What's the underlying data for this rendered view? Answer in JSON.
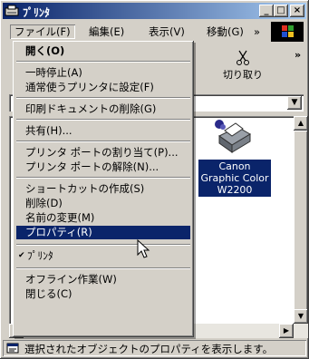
{
  "window": {
    "title": "ﾌﾟﾘﾝﾀ",
    "controls": {
      "minimize": "_",
      "maximize": "□",
      "close": "×"
    }
  },
  "menubar": {
    "items": [
      "ファイル(F)",
      "編集(E)",
      "表示(V)",
      "移動(G)",
      "»"
    ],
    "active_index": 0
  },
  "toolbar": {
    "cut_label": "切り取り",
    "overflow": "»"
  },
  "file_menu": {
    "items": [
      {
        "label": "開く(O)",
        "bold": true
      },
      {
        "separator": true
      },
      {
        "label": "一時停止(A)"
      },
      {
        "label": "通常使うプリンタに設定(F)"
      },
      {
        "separator": true
      },
      {
        "label": "印刷ドキュメントの削除(G)"
      },
      {
        "separator": true
      },
      {
        "label": "共有(H)..."
      },
      {
        "separator": true
      },
      {
        "label": "プリンタ ポートの割り当て(P)..."
      },
      {
        "label": "プリンタ ポートの解除(N)..."
      },
      {
        "separator": true
      },
      {
        "label": "ショートカットの作成(S)"
      },
      {
        "label": "削除(D)"
      },
      {
        "label": "名前の変更(M)"
      },
      {
        "label": "プロパティ(R)",
        "highlighted": true
      },
      {
        "separator": true
      },
      {
        "label": "ﾌﾟﾘﾝﾀ",
        "checked": true
      },
      {
        "separator": true
      },
      {
        "label": "オフライン作業(W)"
      },
      {
        "label": "閉じる(C)"
      }
    ]
  },
  "content": {
    "printer_label": "Canon Graphic Color W2200"
  },
  "statusbar": {
    "text": "選択されたオブジェクトのプロパティを表示します。"
  },
  "colors": {
    "title_gradient_start": "#0a246a",
    "title_gradient_end": "#a6caf0",
    "highlight": "#0a246a",
    "face": "#d4d0c8"
  }
}
